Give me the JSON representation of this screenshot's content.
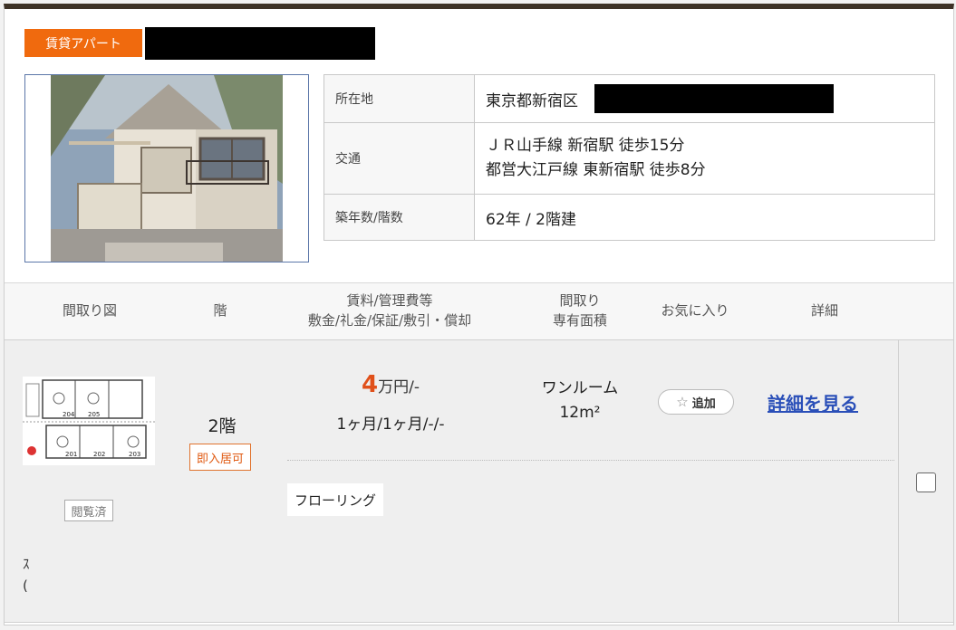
{
  "listing": {
    "type_badge": "賃貸アパート"
  },
  "info": {
    "location_label": "所在地",
    "location_value": "東京都新宿区",
    "transport_label": "交通",
    "transport_line1": "ＪＲ山手線 新宿駅 徒歩15分",
    "transport_line2": "都営大江戸線 東新宿駅 徒歩8分",
    "age_label": "築年数/階数",
    "age_value": "62年 / 2階建"
  },
  "table_header": {
    "floorplan": "間取り図",
    "floor": "階",
    "rent_line1": "賃料/管理費等",
    "rent_line2": "敷金/礼金/保証/敷引・償却",
    "layout_line1": "間取り",
    "layout_line2": "専有面積",
    "favorite": "お気に入り",
    "detail": "詳細"
  },
  "room": {
    "viewed_badge": "閲覧済",
    "floor": "2階",
    "movein_badge": "即入居可",
    "rent_number": "4",
    "rent_unit": "万円/-",
    "deposit": "1ヶ月/1ヶ月/-/-",
    "layout": "ワンルーム",
    "area": "12m²",
    "favorite_button": "追加",
    "favorite_icon": "star-plus-icon",
    "detail_link": "詳細を見る",
    "feature_tag": "フローリング",
    "stray_text_1": "ｽ",
    "stray_text_2": "("
  },
  "floorplan_labels": [
    "204",
    "205",
    "201",
    "202",
    "203"
  ],
  "colors": {
    "badge_orange": "#f06a0e",
    "rent_red": "#e0501a",
    "link_blue": "#2a4fb8",
    "top_border": "#3d3226"
  }
}
